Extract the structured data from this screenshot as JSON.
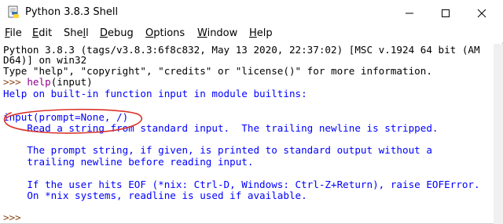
{
  "window": {
    "title": "Python 3.8.3 Shell",
    "icons": {
      "app": "python-idle-icon",
      "minimize": "minimize-icon",
      "maximize": "maximize-icon",
      "close": "close-icon"
    }
  },
  "menu": {
    "file": {
      "u": "F",
      "rest": "ile"
    },
    "edit": {
      "u": "E",
      "rest": "dit"
    },
    "shell": {
      "pre": "She",
      "u": "l",
      "rest": "l"
    },
    "debug": {
      "u": "D",
      "rest": "ebug"
    },
    "options": {
      "u": "O",
      "rest": "ptions"
    },
    "window": {
      "u": "W",
      "rest": "indow"
    },
    "help": {
      "u": "H",
      "rest": "elp"
    }
  },
  "shell": {
    "banner1": "Python 3.8.3 (tags/v3.8.3:6f8c832, May 13 2020, 22:37:02) [MSC v.1924 64 bit (AM",
    "banner2": "D64)] on win32",
    "banner3": "Type \"help\", \"copyright\", \"credits\" or \"license()\" for more information.",
    "prompt1": ">>> ",
    "cmd_func": "help",
    "cmd_args": "(input)",
    "out1": "Help on built-in function input in module builtins:",
    "out2": "",
    "out3": "input(prompt=None, /)",
    "out4": "    Read a string from standard input.  The trailing newline is stripped.",
    "out5": "",
    "out6": "    The prompt string, if given, is printed to standard output without a",
    "out7": "    trailing newline before reading input.",
    "out8": "",
    "out9": "    If the user hits EOF (*nix: Ctrl-D, Windows: Ctrl-Z+Return), raise EOFError.",
    "out10": "    On *nix systems, readline is used if available.",
    "prompt2": ">>> "
  },
  "colors": {
    "output": "#0000ff",
    "builtin": "#900090",
    "annotation": "#d9352b"
  }
}
